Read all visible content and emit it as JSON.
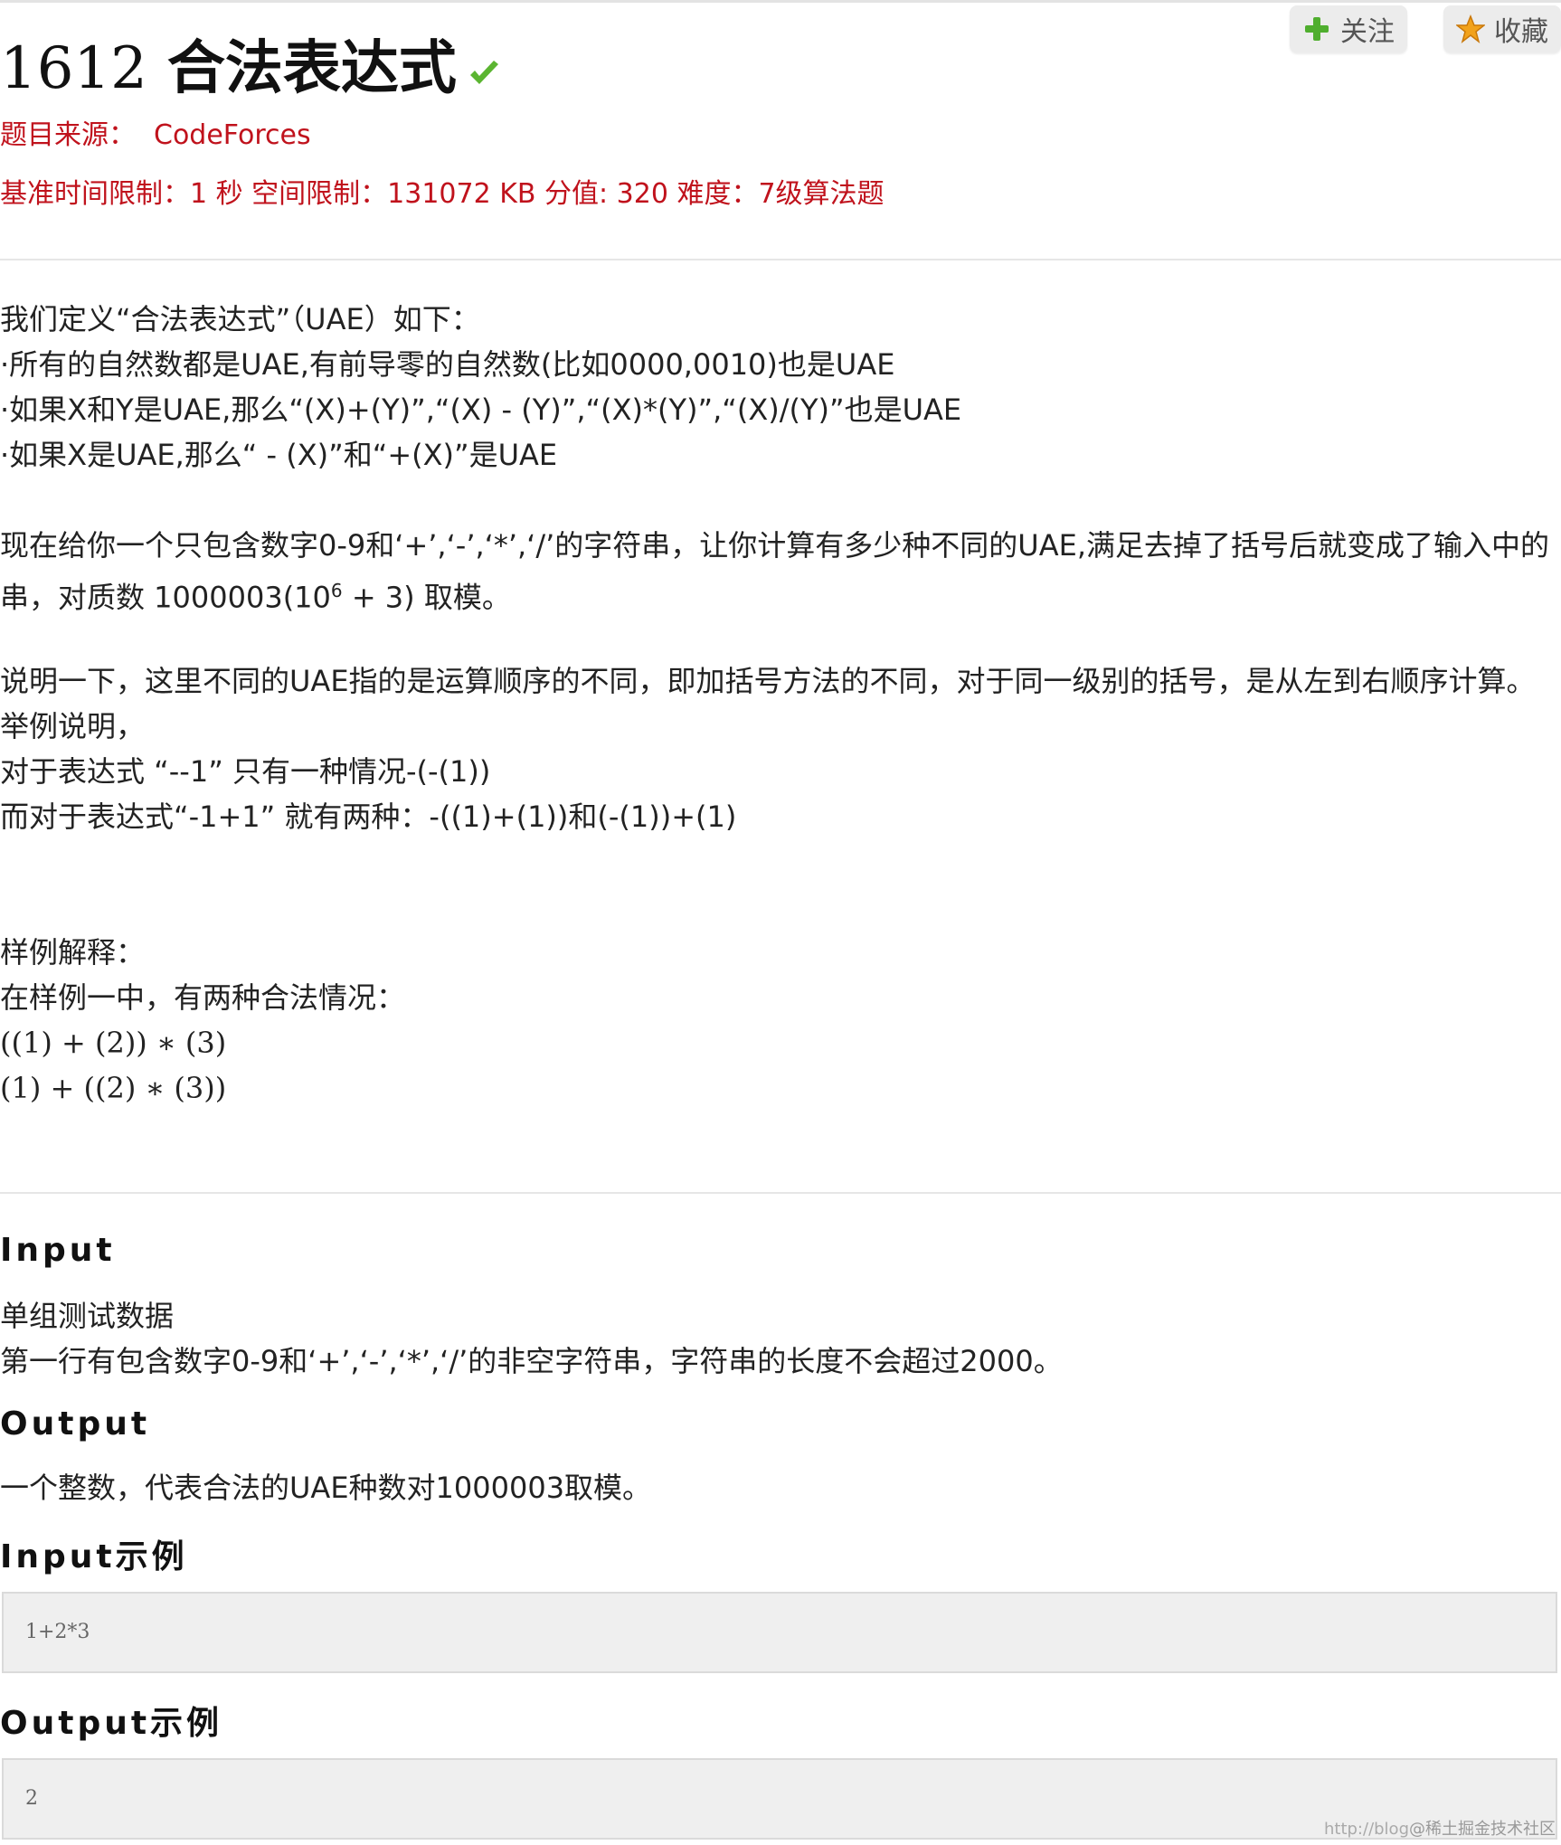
{
  "actions": {
    "follow_label": "关注",
    "collect_label": "收藏"
  },
  "problem": {
    "number": "1612",
    "title": "合法表达式",
    "source_label": "题目来源：",
    "source_name": "CodeForces",
    "limits": "基准时间限制：1 秒 空间限制：131072 KB 分值: 320 难度：7级算法题"
  },
  "description": {
    "def_lines": [
      "我们定义“合法表达式”（UAE）如下：",
      "·所有的自然数都是UAE,有前导零的自然数(比如0000,0010)也是UAE",
      "·如果X和Y是UAE,那么“(X)+(Y)”,“(X) - (Y)”,“(X)*(Y)”,“(X)/(Y)”也是UAE",
      "·如果X是UAE,那么“ - (X)”和“+(X)”是UAE"
    ],
    "task_line1": "现在给你一个只包含数字0-9和‘+’,‘-’,‘*’,‘/’的字符串，让你计算有多少种不同的UAE,满足去掉了括号后就变成了输入中的",
    "task_line2_a": "串，对质数 1000003(10",
    "task_line2_sup": "6",
    "task_line2_b": " + 3) 取模。",
    "explain_lines": [
      "说明一下，这里不同的UAE指的是运算顺序的不同，即加括号方法的不同，对于同一级别的括号，是从左到右顺序计算。",
      "举例说明，",
      "对于表达式 “--1” 只有一种情况-(-(1))",
      "而对于表达式“-1+1” 就有两种：-((1)+(1))和(-(1))+(1)"
    ],
    "sample_lines": [
      "样例解释：",
      "在样例一中，有两种合法情况：",
      " ((1) + (2)) ∗ (3)",
      " (1) + ((2) ∗ (3))"
    ]
  },
  "input_section": {
    "heading": "Input",
    "lines": [
      "单组测试数据",
      "第一行有包含数字0-9和‘+’,‘-’,‘*’,‘/’的非空字符串，字符串的长度不会超过2000。"
    ]
  },
  "output_section": {
    "heading": "Output",
    "text": "一个整数，代表合法的UAE种数对1000003取模。"
  },
  "input_example": {
    "heading": "Input示例",
    "code": "1+2*3"
  },
  "output_example": {
    "heading": "Output示例",
    "code": "2"
  },
  "watermark": {
    "url": "http://blog",
    "site": "@稀土掘金技术社区"
  }
}
